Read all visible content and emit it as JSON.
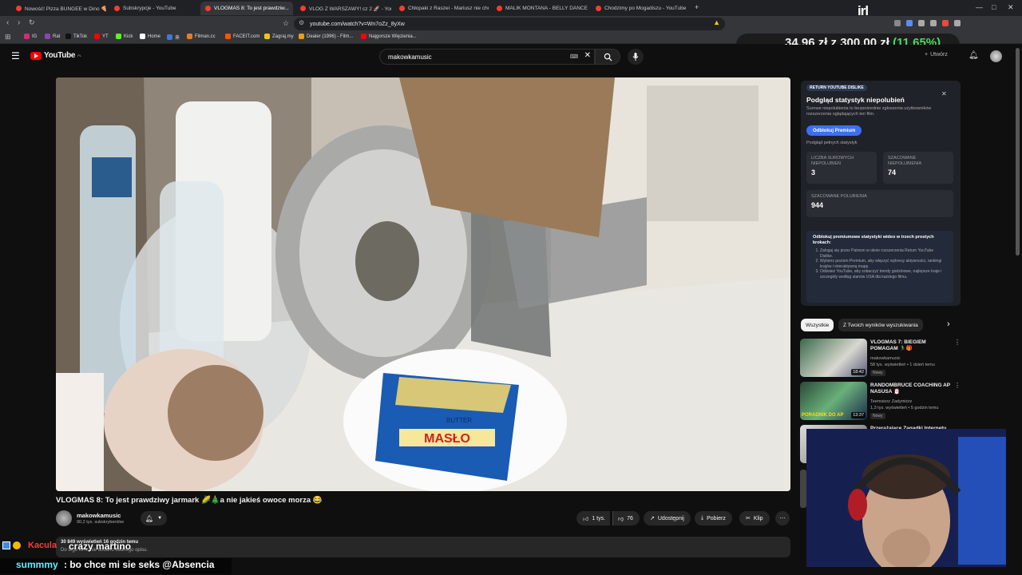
{
  "browser": {
    "tabs": [
      {
        "label": "Nowość! Pizza BUNGEE w Dino 🍕 🎁",
        "color": "#ff3b30",
        "active": false
      },
      {
        "label": "Subskrypcje - YouTube",
        "color": "#ff3b30",
        "active": false
      },
      {
        "label": "VLOGMAS 8: To jest prawdziw...",
        "color": "#ff3b30",
        "active": true
      },
      {
        "label": "VLOG Z WARSZAWY! cz 2 🚀 - YouT...",
        "color": "#ff3b30",
        "active": false
      },
      {
        "label": "Chłopaki z Raszei - Mariusz nie chce...",
        "color": "#ff3b30",
        "active": false
      },
      {
        "label": "MALIK MONTANA - BELLY DANCE X...",
        "color": "#ff3b30",
        "active": false
      },
      {
        "label": "Chodzimy po Mogadiszu - YouTube",
        "color": "#ff3b30",
        "active": false
      }
    ],
    "url": "youtube.com/watch?v=Wn7oZz_8yXw",
    "bookmarks": [
      {
        "label": "IG",
        "color": "#d62976"
      },
      {
        "label": "Rat",
        "color": "#8e44ad"
      },
      {
        "label": "TikTok",
        "color": "#111111"
      },
      {
        "label": "YT",
        "color": "#ff0000"
      },
      {
        "label": "Kick",
        "color": "#53fc18"
      },
      {
        "label": "Home",
        "color": "#ffffff"
      },
      {
        "label": "来",
        "color": "#3a7bd5"
      },
      {
        "label": "Filman.cc",
        "color": "#e67e22"
      },
      {
        "label": "FACEIT.com",
        "color": "#ff5500"
      },
      {
        "label": "Zagraj.my",
        "color": "#f1c40f"
      },
      {
        "label": "Dealer (1996) - Film...",
        "color": "#f39c12"
      },
      {
        "label": "Najgorsze Więzienia...",
        "color": "#ff0000"
      }
    ]
  },
  "overlay": {
    "brand": "irl",
    "donation_text": "34,96 zł z 300,00 zł",
    "donation_percent": "(11.65%)",
    "webcam_label": "streamer-webcam",
    "chat": [
      {
        "user": "Kacula",
        "message": "crazy martino"
      },
      {
        "user": "summmy",
        "message": ": bo chce mi sie seks @Absencia"
      }
    ]
  },
  "youtube": {
    "logo": "YouTube",
    "logo_country": "PL",
    "search_value": "makowkamusic",
    "create_label": "Utwórz",
    "video_title": "VLOGMAS 8: To jest prawdziwy jarmark 🌽🎄a nie jakieś owoce morza 😂",
    "channel_name": "makowkamusic",
    "subscribers": "90,2 tys. subskrybentów",
    "likes": "1 tys.",
    "dislikes": "76",
    "share_label": "Udostępnij",
    "download_label": "Pobierz",
    "clip_label": "Klip",
    "description_line1": "30 849 wyświetleń 16 godzin temu",
    "description_line2": "Do tego filmu nie dodano żadnego opisu.",
    "butter_brand": "MASŁO",
    "butter_sub": "BUTTER"
  },
  "ryd_panel": {
    "brand": "RETURN YOUTUBE DISLIKE",
    "title": "Podgląd statystyk niepolubień",
    "subtitle": "Surowe niepolubienia to bezpośrednie zgłoszenia użytkowników rozszerzenia oglądających ten film.",
    "unlock_button": "Odblokuj Premium",
    "full_stats_link": "Podgląd pełnych statystyk",
    "stats": [
      {
        "label": "LICZBA SUROWYCH NIEPOLUBIEŃ",
        "value": "3"
      },
      {
        "label": "SZACOWANE NIEPOLUBIENIA",
        "value": "74"
      },
      {
        "label": "SZACOWANE POLUBIENIA",
        "value": "944"
      }
    ],
    "promo_title": "Odblokuj premiumowe statystyki wideo w trzech prostych krokach:",
    "promo_steps": [
      "Zaloguj się przez Patreon w oknie rozszerzenia Return YouTube Dislike.",
      "Wybierz poziom Premium, aby włączyć wykresy aktywności, rankingi krajów i interaktywną mapę.",
      "Odśwież YouTube, aby zobaczyć trendy godzinowe, najlepsze kraje i szczegóły według stanów USA dla każdego filmu."
    ]
  },
  "filters": [
    {
      "label": "Wszystkie",
      "active": true
    },
    {
      "label": "Z Twoich wyników wyszukiwania",
      "active": false
    }
  ],
  "recommendations": [
    {
      "title": "VLOGMAS 7: BIEGIEM POMAGAM 🏃‍♂️🎁",
      "channel": "makowkamusic",
      "meta": "58 tys. wyświetleń • 1 dzień temu",
      "badge": "Nowy",
      "duration": "18:42"
    },
    {
      "title": "RANDOMBRUCE COACHING AP NASUSA 🎅🏻",
      "channel": "Teemsiorz Zadymiorz",
      "meta": "1,3 tys. wyświetleń • 5 godzin temu",
      "badge": "Nowy",
      "duration": "13:37"
    },
    {
      "title": "Przerażające Zagadki Internetu",
      "channel": "",
      "meta": "",
      "badge": "",
      "duration": ""
    }
  ],
  "thumb_texts": [
    "PORADNIK DO AP"
  ]
}
